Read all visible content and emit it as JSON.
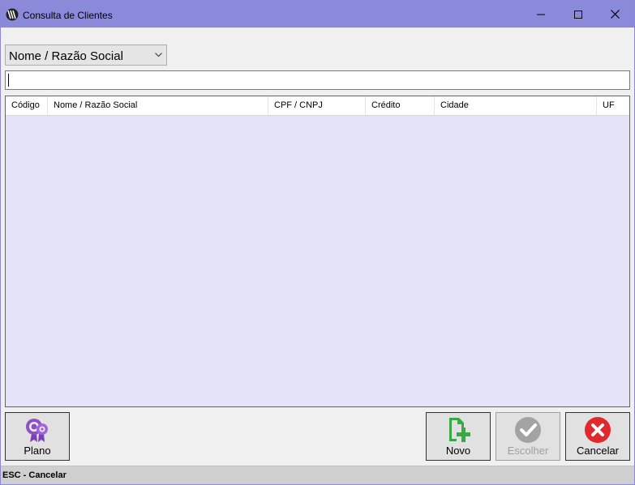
{
  "window": {
    "title": "Consulta de Clientes",
    "titlebar_color": "#8b89d9"
  },
  "search": {
    "mode_selected": "Nome / Razão Social",
    "value": ""
  },
  "grid": {
    "columns": [
      "Código",
      "Nome / Razão Social",
      "CPF / CNPJ",
      "Crédito",
      "Cidade",
      "UF"
    ],
    "rows": [],
    "background": "#e4e4f8"
  },
  "buttons": {
    "plano": {
      "label": "Plano",
      "icon": "settings-badge-icon"
    },
    "novo": {
      "label": "Novo",
      "icon": "new-document-plus-icon"
    },
    "escolher": {
      "label": "Escolher",
      "icon": "check-circle-icon",
      "enabled": false
    },
    "cancelar": {
      "label": "Cancelar",
      "icon": "cancel-circle-icon"
    }
  },
  "statusbar": {
    "text": "ESC - Cancelar"
  }
}
